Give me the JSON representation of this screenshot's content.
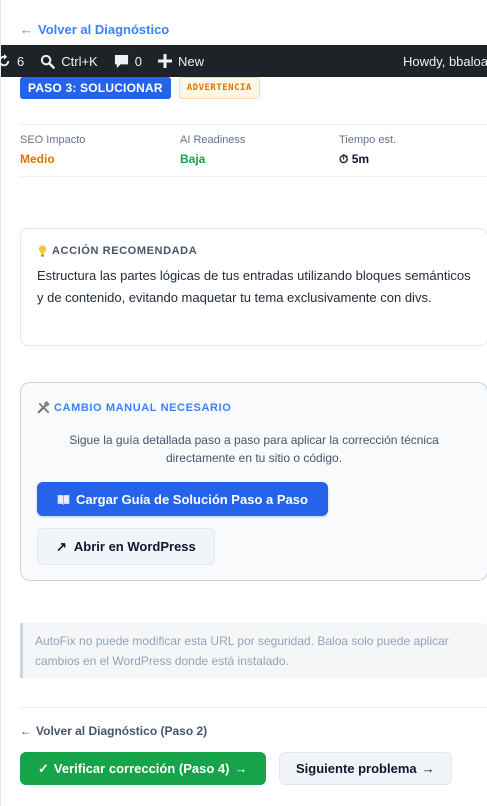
{
  "nav": {
    "back_top": "Volver al Diagnóstico",
    "back_bottom": "Volver al Diagnóstico (Paso 2)",
    "arrow": "←"
  },
  "adminbar": {
    "updates_count": "6",
    "search_shortcut": "Ctrl+K",
    "comments_count": "0",
    "new_label": "New",
    "howdy": "Howdy, bbaloa"
  },
  "badges": {
    "step": "PASO 3: SOLUCIONAR",
    "severity": "ADVERTENCIA"
  },
  "metrics": [
    {
      "label": "SEO Impacto",
      "value": "Medio",
      "color": "#d97706"
    },
    {
      "label": "AI Readiness",
      "value": "Baja",
      "color": "#16a34a"
    },
    {
      "label": "Tiempo est.",
      "value": "5m",
      "icon": "⏱",
      "color": "#0f172a"
    }
  ],
  "action_card": {
    "icon": "lightbulb-icon",
    "title": "ACCIÓN RECOMENDADA",
    "text": "Estructura las partes lógicas de tus entradas utilizando bloques semánticos y de contenido, evitando maquetar tu tema exclusivamente con divs."
  },
  "manual_card": {
    "icon": "tools-icon",
    "title": "CAMBIO MANUAL NECESARIO",
    "description": "Sigue la guía detallada paso a paso para aplicar la corrección técnica directamente en tu sitio o código.",
    "primary_button": "Cargar Guía de Solución Paso a Paso",
    "secondary_button": "Abrir en WordPress",
    "secondary_icon": "↗"
  },
  "notice": {
    "text": "AutoFix no puede modificar esta URL por seguridad. Baloa solo puede aplicar cambios en el WordPress donde está instalado."
  },
  "footer": {
    "verify_button": "Verificar corrección (Paso 4)",
    "verify_check": "✓",
    "verify_arrow": "→",
    "next_button": "Siguiente problema",
    "next_arrow": "→"
  },
  "colors": {
    "primary": "#2563eb",
    "success": "#16a34a",
    "warning": "#d97706",
    "adminbar": "#1d2327"
  }
}
